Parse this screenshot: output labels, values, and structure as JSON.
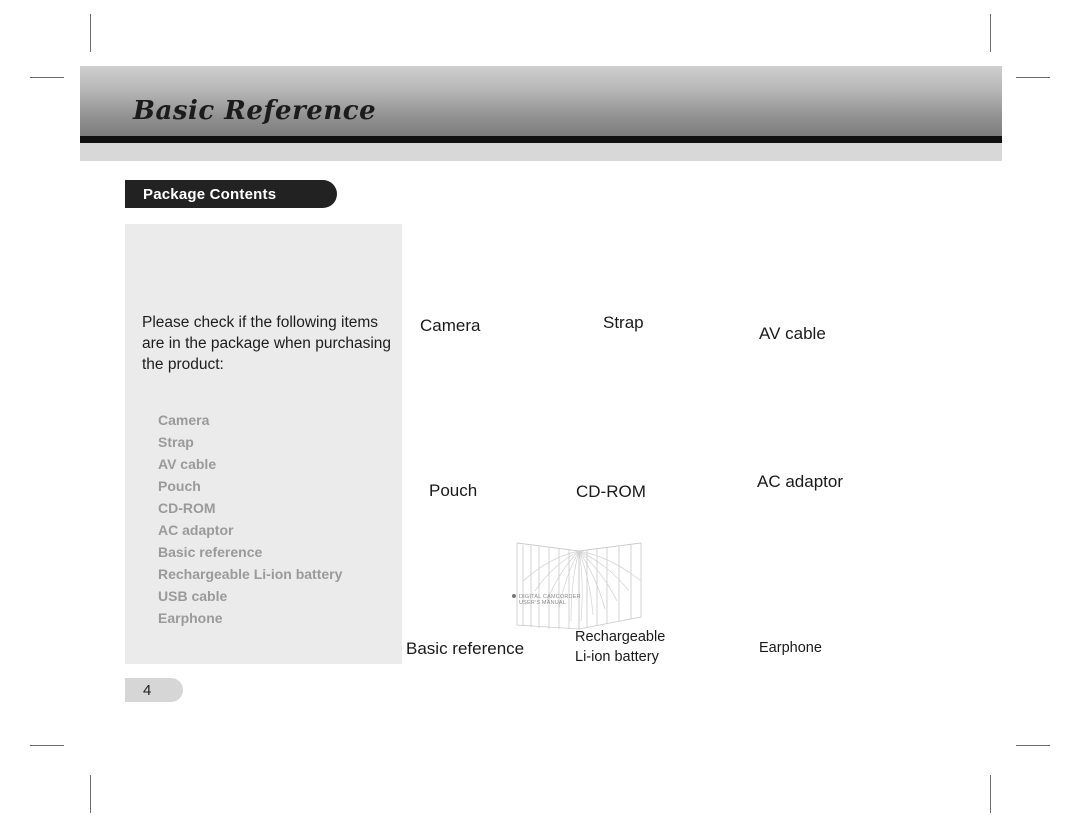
{
  "header": {
    "title": "Basic Reference"
  },
  "section": {
    "tab_label": "Package Contents"
  },
  "left_panel": {
    "intro": "Please check if the following items are in  the package when purchasing the product:",
    "items": [
      "Camera",
      "Strap",
      "AV cable",
      "Pouch",
      "CD-ROM",
      "AC adaptor",
      "Basic reference",
      "Rechargeable Li-ion battery",
      "USB cable",
      "Earphone"
    ]
  },
  "page_number": "4",
  "grid": {
    "cells": [
      {
        "label": "Camera",
        "size": "large"
      },
      {
        "label": "Strap",
        "size": "large"
      },
      {
        "label": "AV cable",
        "size": "large"
      },
      {
        "label": "Pouch",
        "size": "large"
      },
      {
        "label": "CD-ROM",
        "size": "large"
      },
      {
        "label": "AC adaptor",
        "size": "large"
      },
      {
        "label": "Basic reference",
        "size": "large"
      },
      {
        "label": "Rechargeable\nLi-ion battery",
        "size": "small"
      },
      {
        "label": "Earphone",
        "size": "small"
      }
    ]
  },
  "booklet": {
    "cover_line1": "DIGITAL CAMCORDER",
    "cover_line2": "USER'S MANUAL"
  },
  "colors": {
    "header_dark": "#111111",
    "tab_background": "#222222",
    "panel_background": "#ebebeb",
    "list_text": "#9a9a9a"
  }
}
